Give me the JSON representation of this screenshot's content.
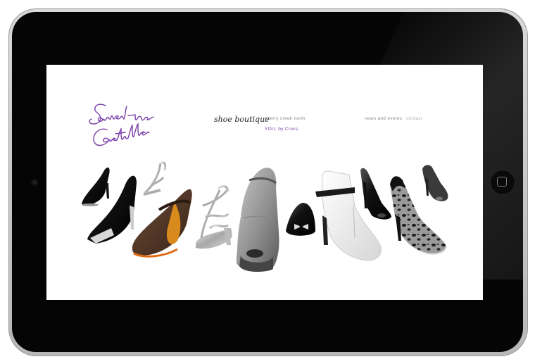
{
  "brand": {
    "logo_line1": "Samantha",
    "logo_line2": "Castilla",
    "logo_color": "#7a3fa8"
  },
  "nav": {
    "shoe_boutique": "shoe boutique",
    "cherry_creek": "cherry creek north",
    "crocs": "YOU, by Crocs",
    "news_events": "news and events",
    "contact": "contact"
  },
  "device": {
    "camera_icon": "camera-icon",
    "home_icon": "home-button-icon"
  },
  "products": [
    {
      "name": "black-patent-pump"
    },
    {
      "name": "black-silver-peep-toe-heel"
    },
    {
      "name": "silver-strappy-sandal"
    },
    {
      "name": "brown-suede-wedge-mary-jane"
    },
    {
      "name": "silver-caged-sandal"
    },
    {
      "name": "grey-peep-toe-mary-jane"
    },
    {
      "name": "black-bow-ballet-flat"
    },
    {
      "name": "white-ankle-strap-bootie"
    },
    {
      "name": "black-peep-toe-pump"
    },
    {
      "name": "leopard-print-pump"
    },
    {
      "name": "grey-peep-toe-bootie"
    }
  ]
}
